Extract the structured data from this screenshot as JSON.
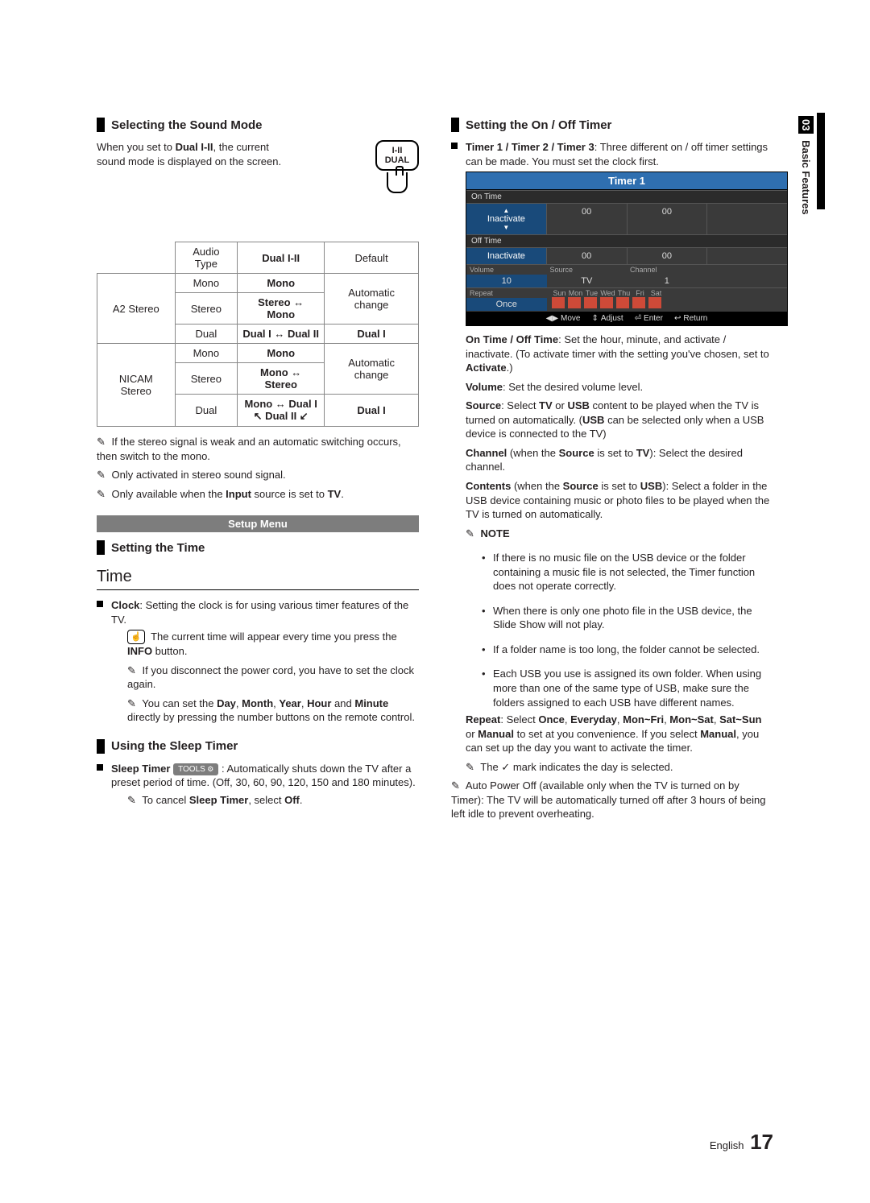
{
  "sidebar": {
    "chapter_num": "03",
    "chapter_name": "Basic Features"
  },
  "footer": {
    "lang": "English",
    "page": "17"
  },
  "left": {
    "sound_mode_heading": "Selecting the Sound Mode",
    "sound_mode_text_1": "When you set to ",
    "sound_mode_text_bold": "Dual I-II",
    "sound_mode_text_2": ", the current sound mode is displayed on the screen.",
    "dual_btn_line1": "I-II",
    "dual_btn_line2": "DUAL",
    "table": {
      "head": {
        "c1": "",
        "c2": "Audio Type",
        "c3": "Dual I-II",
        "c4": "Default"
      },
      "a2": {
        "name": "A2 Stereo",
        "r1": {
          "t": "Mono",
          "d": "Mono",
          "def": "Automatic change"
        },
        "r2": {
          "t": "Stereo",
          "d": "Stereo ↔ Mono"
        },
        "r3": {
          "t": "Dual",
          "d": "Dual I ↔ Dual II",
          "def": "Dual I"
        }
      },
      "nicam": {
        "name": "NICAM Stereo",
        "r1": {
          "t": "Mono",
          "d": "Mono",
          "def": "Automatic change"
        },
        "r2": {
          "t": "Stereo",
          "d": "Mono ↔ Stereo"
        },
        "r3": {
          "t": "Dual",
          "d": "Mono ↔ Dual I\n↖ Dual II ↙",
          "def": "Dual I"
        }
      }
    },
    "sound_notes": [
      "If the stereo signal is weak and an automatic switching occurs, then switch to the mono.",
      "Only activated in stereo sound signal.",
      "Only available when the Input source is set to TV."
    ],
    "sound_note3_bold1": "Input",
    "sound_note3_bold2": "TV",
    "setup_menu": "Setup Menu",
    "time_heading": "Setting the Time",
    "time_title": "Time",
    "clock_lead_bold": "Clock",
    "clock_lead_rest": ": Setting the clock is for using various timer features of the TV.",
    "clock_info": "The current time will appear every time you press the INFO button.",
    "clock_info_bold": "INFO",
    "clock_n1": "If you disconnect the power cord, you have to set the clock again.",
    "clock_n2_a": "You can set the ",
    "clock_n2_b": "Day",
    "clock_n2_c": ", ",
    "clock_n2_d": "Month",
    "clock_n2_e": ", ",
    "clock_n2_f": "Year",
    "clock_n2_g": ", ",
    "clock_n2_h": "Hour",
    "clock_n2_i": " and ",
    "clock_n2_j": "Minute",
    "clock_n2_k": " directly by pressing the number buttons on the remote control.",
    "sleep_heading": "Using the Sleep Timer",
    "sleep_bold": "Sleep Timer ",
    "sleep_tools": "TOOLS",
    "sleep_rest": ": Automatically shuts down the TV after a preset period of time. (Off, 30, 60, 90, 120, 150 and 180 minutes).",
    "sleep_note_a": "To cancel ",
    "sleep_note_b": "Sleep Timer",
    "sleep_note_c": ", select ",
    "sleep_note_d": "Off",
    "sleep_note_e": "."
  },
  "right": {
    "onoff_heading": "Setting the On / Off Timer",
    "timer_lead_bold": "Timer 1 / Timer 2 / Timer 3",
    "timer_lead_rest": ": Three different on / off timer settings can be made. You must set the clock first.",
    "panel": {
      "title": "Timer 1",
      "on_label": "On Time",
      "off_label": "Off Time",
      "inactivate": "Inactivate",
      "hh": "00",
      "mm": "00",
      "vol_label": "Volume",
      "vol": "10",
      "src_label": "Source",
      "src": "TV",
      "ch_label": "Channel",
      "ch": "1",
      "rpt_label": "Repeat",
      "rpt": "Once",
      "days": [
        "Sun",
        "Mon",
        "Tue",
        "Wed",
        "Thu",
        "Fri",
        "Sat"
      ],
      "foot": {
        "move": "Move",
        "adj": "Adjust",
        "ent": "Enter",
        "ret": "Return"
      }
    },
    "p_ontime_a": "On Time / Off Time",
    "p_ontime_b": ": Set the hour, minute, and activate / inactivate. (To activate timer with the setting you've chosen, set to ",
    "p_ontime_c": "Activate",
    "p_ontime_d": ".)",
    "p_vol_a": "Volume",
    "p_vol_b": ": Set the desired volume level.",
    "p_src_a": "Source",
    "p_src_b": ": Select ",
    "p_src_c": "TV",
    "p_src_d": " or ",
    "p_src_e": "USB",
    "p_src_f": " content to be played when the TV is turned on automatically. (",
    "p_src_g": "USB",
    "p_src_h": " can be selected only when a USB device is connected to the TV)",
    "p_ch_a": "Channel",
    "p_ch_b": " (when the ",
    "p_ch_c": "Source",
    "p_ch_d": " is set to ",
    "p_ch_e": "TV",
    "p_ch_f": "): Select the desired channel.",
    "p_cont_a": "Contents",
    "p_cont_b": " (when the ",
    "p_cont_c": "Source",
    "p_cont_d": " is set to ",
    "p_cont_e": "USB",
    "p_cont_f": "): Select a folder in the USB device containing music or photo files to be played when the TV is turned on automatically.",
    "note_label": "NOTE",
    "notes": [
      "If there is no music file on the USB device or the folder containing a music file is not selected, the Timer function does not operate correctly.",
      "When there is only one photo file in the USB device, the Slide Show will not play.",
      "If a folder name is too long, the folder cannot be selected.",
      "Each USB you use is assigned its own folder. When using more than one of the same type of USB, make sure the folders assigned to each USB have different names."
    ],
    "p_rpt_a": "Repeat",
    "p_rpt_b": ": Select ",
    "p_rpt_c": "Once",
    "p_rpt_d": ", ",
    "p_rpt_e": "Everyday",
    "p_rpt_f": ", ",
    "p_rpt_g": "Mon~Fri",
    "p_rpt_h": ", ",
    "p_rpt_i": "Mon~Sat",
    "p_rpt_j": ", ",
    "p_rpt_k": "Sat~Sun",
    "p_rpt_l": " or ",
    "p_rpt_m": "Manual",
    "p_rpt_n": " to set at you convenience. If you select ",
    "p_rpt_o": "Manual",
    "p_rpt_p": ", you can set up the day you want to activate the timer.",
    "p_check": "The ✓ mark indicates the day is selected.",
    "p_apo": "Auto Power Off (available only when the TV is turned on by Timer): The TV will be automatically turned off after 3 hours of being left idle to prevent overheating."
  }
}
